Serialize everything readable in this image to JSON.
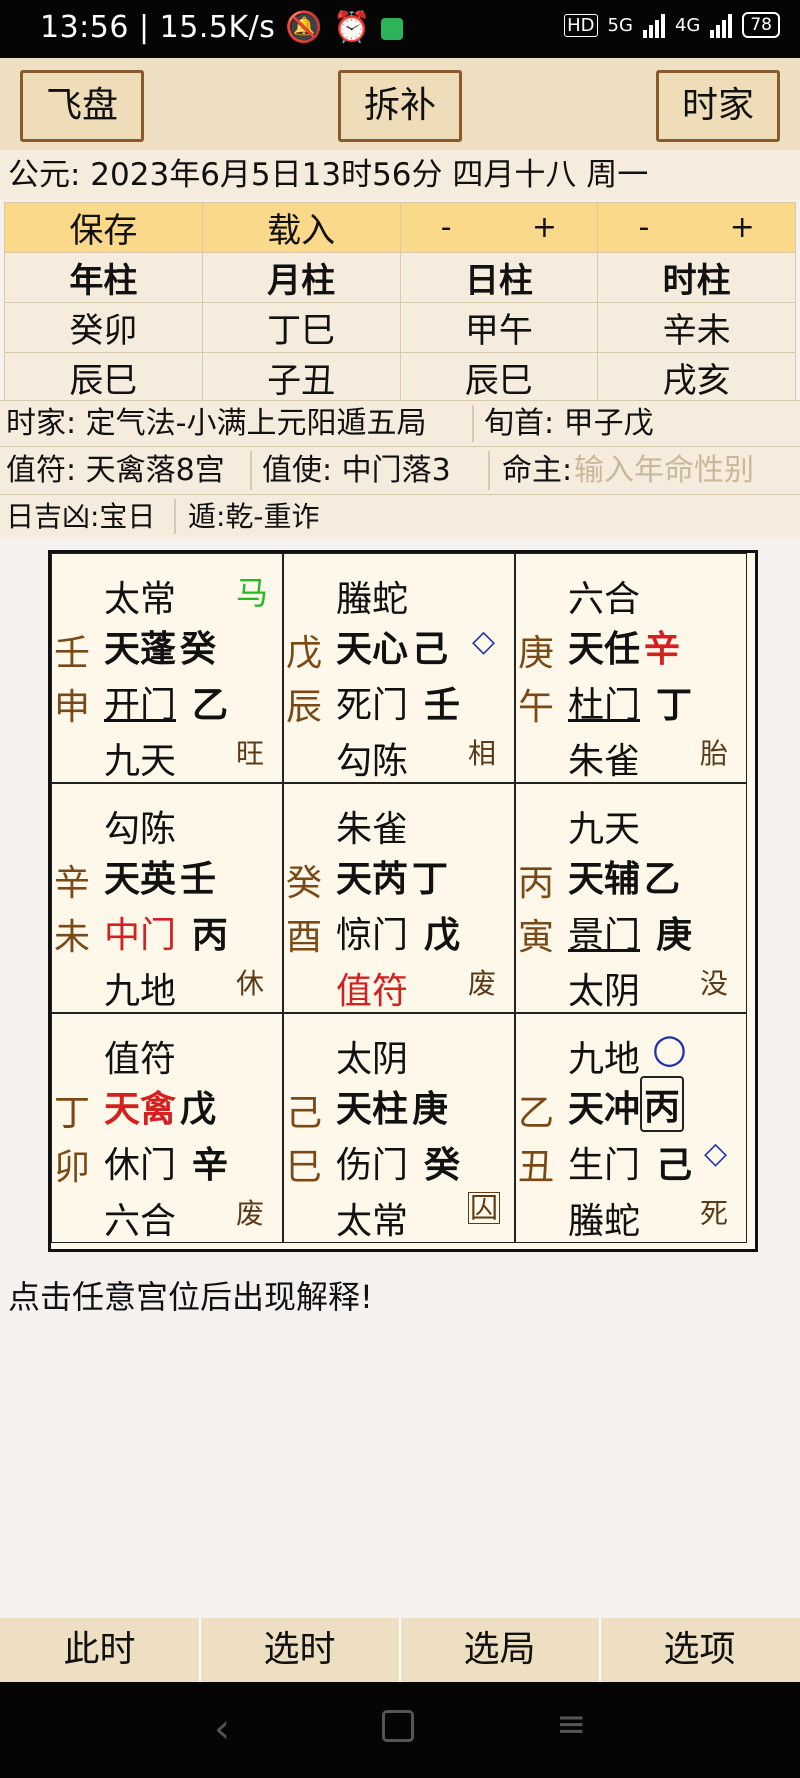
{
  "status": {
    "time": "13:56",
    "speed": "15.5K/s",
    "hd": "HD",
    "net1": "5G",
    "net2": "4G",
    "battery": "78"
  },
  "toolbar": {
    "feipan": "飞盘",
    "chaibu": "拆补",
    "shijia": "时家"
  },
  "date_line": "公元: 2023年6月5日13时56分 四月十八 周一",
  "actions": {
    "save": "保存",
    "load": "载入",
    "minus": "-",
    "plus": "+"
  },
  "pillars": {
    "headers": [
      "年柱",
      "月柱",
      "日柱",
      "时柱"
    ],
    "row1": [
      "癸卯",
      "丁巳",
      "甲午",
      "辛未"
    ],
    "row2": [
      "辰巳",
      "子丑",
      "辰巳",
      "戌亥"
    ]
  },
  "info": {
    "shijia": "时家: 定气法-小满上元阳遁五局",
    "xunshou": "旬首: 甲子戊",
    "zhifu": "值符: 天禽落8宫",
    "zhishi": "值使: 中门落3",
    "mingzhu_label": "命主:",
    "mingzhu_placeholder": "输入年命性别",
    "rijixiong": "日吉凶:宝日",
    "dun": "遁:乾-重诈"
  },
  "palaces": [
    {
      "god": "太常",
      "mark": "马",
      "g1": "壬",
      "g2": "申",
      "star": "天蓬",
      "star_stem": "癸",
      "door": "开门",
      "door_stem": "乙",
      "spirit": "九天",
      "state": "旺"
    },
    {
      "god": "螣蛇",
      "mark": "◇",
      "g1": "戊",
      "g2": "辰",
      "star": "天心",
      "star_stem": "己",
      "door": "死门",
      "door_stem": "壬",
      "spirit": "勾陈",
      "state": "相"
    },
    {
      "god": "六合",
      "mark": "",
      "g1": "庚",
      "g2": "午",
      "star": "天任",
      "star_stem": "辛",
      "door": "杜门",
      "door_stem": "丁",
      "spirit": "朱雀",
      "state": "胎"
    },
    {
      "god": "勾陈",
      "mark": "",
      "g1": "辛",
      "g2": "未",
      "star": "天英",
      "star_stem": "壬",
      "door": "中门",
      "door_stem": "丙",
      "spirit": "九地",
      "state": "休"
    },
    {
      "god": "朱雀",
      "mark": "",
      "g1": "癸",
      "g2": "酉",
      "star": "天芮",
      "star_stem": "丁",
      "door": "惊门",
      "door_stem": "戊",
      "spirit": "值符",
      "state": "废"
    },
    {
      "god": "九天",
      "mark": "",
      "g1": "丙",
      "g2": "寅",
      "star": "天辅",
      "star_stem": "乙",
      "door": "景门",
      "door_stem": "庚",
      "spirit": "太阴",
      "state": "没"
    },
    {
      "god": "值符",
      "mark": "",
      "g1": "丁",
      "g2": "卯",
      "star": "天禽",
      "star_stem": "戊",
      "door": "休门",
      "door_stem": "辛",
      "spirit": "六合",
      "state": "废"
    },
    {
      "god": "太阴",
      "mark": "",
      "g1": "己",
      "g2": "巳",
      "star": "天柱",
      "star_stem": "庚",
      "door": "伤门",
      "door_stem": "癸",
      "spirit": "太常",
      "state": "囚"
    },
    {
      "god": "九地",
      "mark": "○",
      "g1": "乙",
      "g2": "丑",
      "star": "天冲",
      "star_stem": "丙",
      "door": "生门",
      "door_stem": "己",
      "spirit": "螣蛇",
      "state": "死",
      "mark2": "◇"
    }
  ],
  "hint": "点击任意宫位后出现解释!",
  "bottom": {
    "cishi": "此时",
    "xuanshi": "选时",
    "xuanju": "选局",
    "xuanxiang": "选项"
  }
}
